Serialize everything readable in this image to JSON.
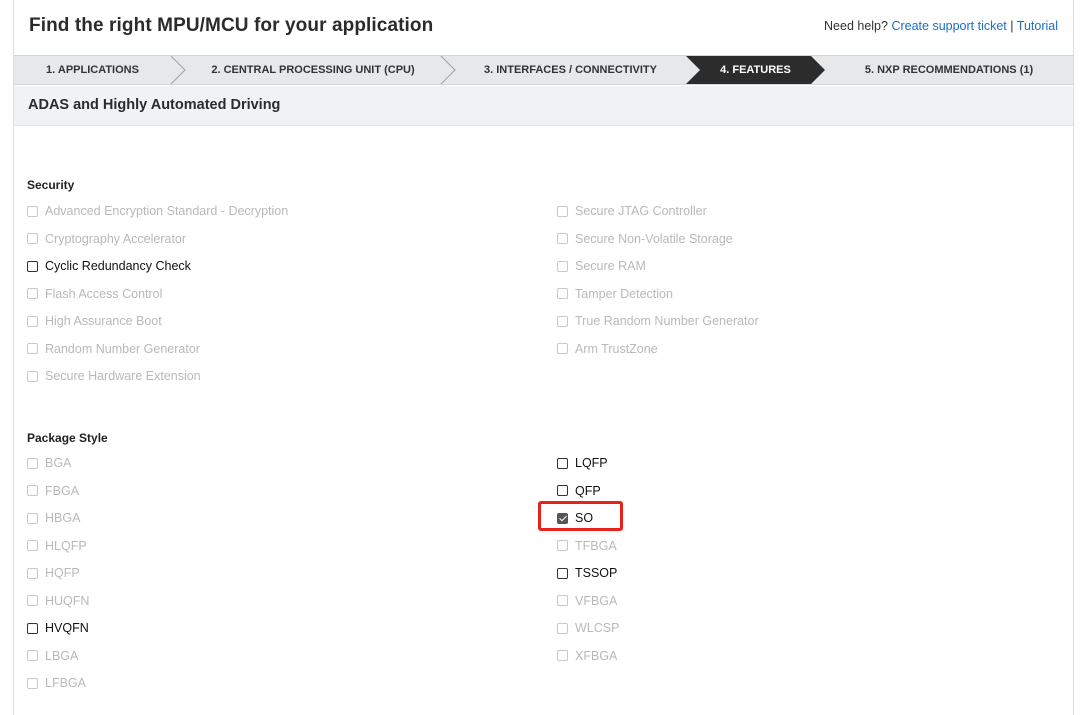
{
  "header": {
    "title": "Find the right MPU/MCU for your application",
    "help_prefix": "Need help?",
    "support_link": "Create support ticket",
    "separator": "|",
    "tutorial_link": "Tutorial"
  },
  "steps": [
    {
      "label": "1. APPLICATIONS",
      "active": false
    },
    {
      "label": "2. CENTRAL PROCESSING UNIT (CPU)",
      "active": false
    },
    {
      "label": "3. INTERFACES / CONNECTIVITY",
      "active": false
    },
    {
      "label": "4. FEATURES",
      "active": true
    },
    {
      "label": "5. NXP RECOMMENDATIONS (1)",
      "active": false
    }
  ],
  "section": {
    "label": "ADAS and Highly Automated Driving"
  },
  "security": {
    "title": "Security",
    "left": [
      {
        "label": "Advanced Encryption Standard - Decryption",
        "state": "disabled"
      },
      {
        "label": "Cryptography Accelerator",
        "state": "disabled"
      },
      {
        "label": "Cyclic Redundancy Check",
        "state": "enabled"
      },
      {
        "label": "Flash Access Control",
        "state": "disabled"
      },
      {
        "label": "High Assurance Boot",
        "state": "disabled"
      },
      {
        "label": "Random Number Generator",
        "state": "disabled"
      },
      {
        "label": "Secure Hardware Extension",
        "state": "disabled"
      }
    ],
    "right": [
      {
        "label": "Secure JTAG Controller",
        "state": "disabled"
      },
      {
        "label": "Secure Non-Volatile Storage",
        "state": "disabled"
      },
      {
        "label": "Secure RAM",
        "state": "disabled"
      },
      {
        "label": "Tamper Detection",
        "state": "disabled"
      },
      {
        "label": "True Random Number Generator",
        "state": "disabled"
      },
      {
        "label": "Arm TrustZone",
        "state": "disabled"
      }
    ]
  },
  "package": {
    "title": "Package Style",
    "left": [
      {
        "label": "BGA",
        "state": "disabled"
      },
      {
        "label": "FBGA",
        "state": "disabled"
      },
      {
        "label": "HBGA",
        "state": "disabled"
      },
      {
        "label": "HLQFP",
        "state": "disabled"
      },
      {
        "label": "HQFP",
        "state": "disabled"
      },
      {
        "label": "HUQFN",
        "state": "disabled"
      },
      {
        "label": "HVQFN",
        "state": "enabled"
      },
      {
        "label": "LBGA",
        "state": "disabled"
      },
      {
        "label": "LFBGA",
        "state": "disabled"
      }
    ],
    "right": [
      {
        "label": "LQFP",
        "state": "enabled"
      },
      {
        "label": "QFP",
        "state": "enabled"
      },
      {
        "label": "SO",
        "state": "checked"
      },
      {
        "label": "TFBGA",
        "state": "disabled"
      },
      {
        "label": "TSSOP",
        "state": "enabled"
      },
      {
        "label": "VFBGA",
        "state": "disabled"
      },
      {
        "label": "WLCSP",
        "state": "disabled"
      },
      {
        "label": "XFBGA",
        "state": "disabled"
      }
    ]
  },
  "colors": {
    "link": "#1a6fc9",
    "active_step": "#2c2c2c",
    "highlight": "#e8211a",
    "disabled_text": "#b9b9b9"
  }
}
